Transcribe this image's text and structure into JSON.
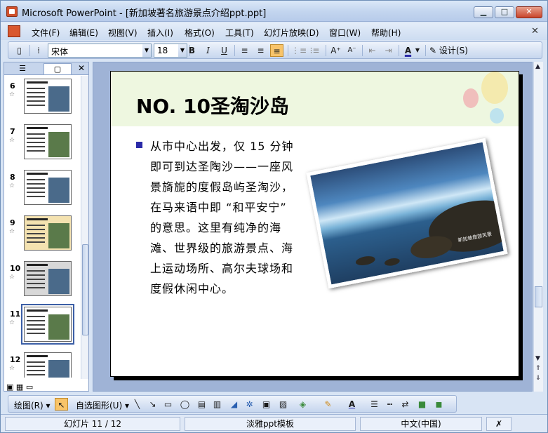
{
  "window": {
    "title": "Microsoft PowerPoint - [新加坡著名旅游景点介绍ppt.ppt]",
    "min_symbol": "▁",
    "max_symbol": "□",
    "close_symbol": "✕"
  },
  "menu": {
    "items": [
      "文件(F)",
      "编辑(E)",
      "视图(V)",
      "插入(I)",
      "格式(O)",
      "工具(T)",
      "幻灯片放映(D)",
      "窗口(W)",
      "帮助(H)"
    ],
    "close_symbol": "✕"
  },
  "format_toolbar": {
    "font": "宋体",
    "size": "18",
    "bold": "B",
    "italic": "I",
    "underline": "U",
    "font_color": "A",
    "design": "设计(S)"
  },
  "slide_pane": {
    "tab_close": "✕",
    "thumbnails": [
      {
        "num": "6",
        "bg": "#ffffff"
      },
      {
        "num": "7",
        "bg": "#ffffff"
      },
      {
        "num": "8",
        "bg": "#ffffff"
      },
      {
        "num": "9",
        "bg": "#f4e2b0"
      },
      {
        "num": "10",
        "bg": "#d8d8d8"
      },
      {
        "num": "11",
        "bg": "#ffffff",
        "selected": true
      },
      {
        "num": "12",
        "bg": "#ffffff"
      }
    ]
  },
  "slide": {
    "title": "NO. 10圣淘沙岛",
    "body": "从市中心出发，仅 15 分钟即可到达圣陶沙——一座风景旖旎的度假岛屿圣淘沙，在马来语中即 “和平安宁” 的意思。这里有纯净的海滩、世界级的旅游景点、海上运动场所、高尔夫球场和度假休闲中心。",
    "photo_caption": "新加坡旅游风景",
    "bullet_color": "#2a2aa8",
    "header_color": "#eef7e0"
  },
  "draw_toolbar": {
    "draw": "绘图(R) ▾",
    "autoshapes": "自选图形(U) ▾"
  },
  "status": {
    "slide": "幻灯片 11 / 12",
    "design": "淡雅ppt模板",
    "language": "中文(中国)"
  }
}
